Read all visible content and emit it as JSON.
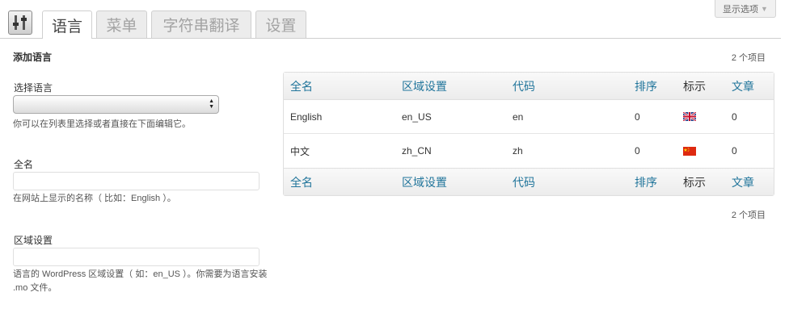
{
  "header": {
    "tabs": [
      {
        "label": "语言",
        "active": true
      },
      {
        "label": "菜单",
        "active": false
      },
      {
        "label": "字符串翻译",
        "active": false
      },
      {
        "label": "设置",
        "active": false
      }
    ],
    "screen_options": "显示选项",
    "screen_options_icon": "triangle-down-icon",
    "plugin_icon": "sliders-icon"
  },
  "form": {
    "section_title": "添加语言",
    "choose_language": {
      "label": "选择语言",
      "value": "",
      "help": "你可以在列表里选择或者直接在下面编辑它。"
    },
    "full_name": {
      "label": "全名",
      "value": "",
      "help": "在网站上显示的名称（ 比如：English ）。"
    },
    "locale": {
      "label": "区域设置",
      "value": "",
      "help": "语言的 WordPress 区域设置（ 如：en_US ）。你需要为语言安装 .mo 文件。"
    }
  },
  "table": {
    "item_count": "2 个项目",
    "columns": [
      "全名",
      "区域设置",
      "代码",
      "排序",
      "标示",
      "文章"
    ],
    "rows": [
      {
        "name": "English",
        "locale": "en_US",
        "code": "en",
        "order": "0",
        "flag": "uk-flag-icon",
        "posts": "0"
      },
      {
        "name": "中文",
        "locale": "zh_CN",
        "code": "zh",
        "order": "0",
        "flag": "china-flag-icon",
        "posts": "0"
      }
    ]
  },
  "colors": {
    "link": "#21759b",
    "border": "#dfdfdf"
  }
}
